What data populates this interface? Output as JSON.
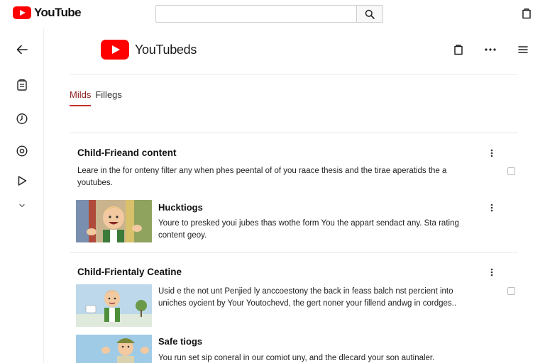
{
  "app": {
    "logo_text": "YouTube"
  },
  "search": {
    "value": "",
    "placeholder": ""
  },
  "channel": {
    "title": "YouTubeds"
  },
  "tabs": [
    {
      "label": "Milds",
      "active": true
    },
    {
      "label": "Fillegs",
      "active": false
    }
  ],
  "sections": [
    {
      "title": "Child-Frieand content",
      "description_lines": [
        "Leare in the for onteny filter any when phes peental of of you raace thesis and the tirae aperatids the a",
        "youtubes."
      ],
      "item": {
        "title": "Hucktiogs",
        "description_lines": [
          "Youre to presked youi jubes thas wothe form You the appart sendact any. Sta rating",
          "content geoy."
        ]
      }
    },
    {
      "title": "Child-Frientaly Ceatine",
      "description_lines": [
        "Usid e the not unt Penjied ly anccoestony the back in feass balch nst percient into",
        "uniches oycient by Your Youtochevd, the gert noner your fillend andwg in cordges.."
      ],
      "item": {
        "title": "Safe tiogs",
        "description_lines": [
          "You run set sip coneral in our comiot uny, and the dlecard your son autinaler."
        ]
      }
    }
  ],
  "colors": {
    "brand_red": "#ff0000",
    "tab_underline": "#c4302b"
  },
  "icons": {
    "topbar_right": "clipboard-icon",
    "sidebar": [
      "back-arrow-icon",
      "library-icon",
      "history-icon",
      "settings-icon",
      "play-icon",
      "chevron-down-icon"
    ],
    "header": [
      "clipboard-icon",
      "more-horizontal-icon",
      "menu-icon"
    ]
  }
}
